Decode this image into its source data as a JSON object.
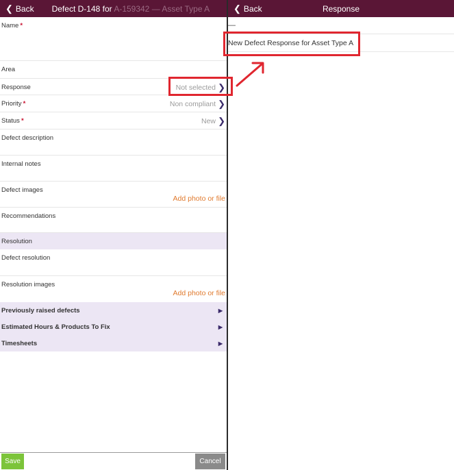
{
  "left": {
    "back_label": "Back",
    "title_main": "Defect D-148 for ",
    "title_sub": "A-159342 — Asset Type A",
    "fields": {
      "name": "Name",
      "area": "Area",
      "response": "Response",
      "response_value": "Not selected",
      "priority": "Priority",
      "priority_value": "Non compliant",
      "status": "Status",
      "status_value": "New",
      "defect_description": "Defect description",
      "internal_notes": "Internal notes",
      "defect_images": "Defect images",
      "add_photo_1": "Add photo or file",
      "recommendations": "Recommendations",
      "resolution_section": "Resolution",
      "defect_resolution": "Defect resolution",
      "resolution_images": "Resolution images",
      "add_photo_2": "Add photo or file"
    },
    "sections": {
      "previously_raised": "Previously raised defects",
      "estimated_hours": "Estimated Hours & Products To Fix",
      "timesheets": "Timesheets"
    },
    "save_label": "Save",
    "cancel_label": "Cancel"
  },
  "right": {
    "back_label": "Back",
    "title": "Response",
    "empty_option": "—",
    "option_1": "New Defect Response for Asset Type A"
  },
  "colors": {
    "header": "#5a1636",
    "section_bg": "#ece6f4",
    "accent_orange": "#e07a2e",
    "highlight_red": "#e0262f",
    "save_green": "#7cc43a",
    "required_red": "#c8102e"
  }
}
